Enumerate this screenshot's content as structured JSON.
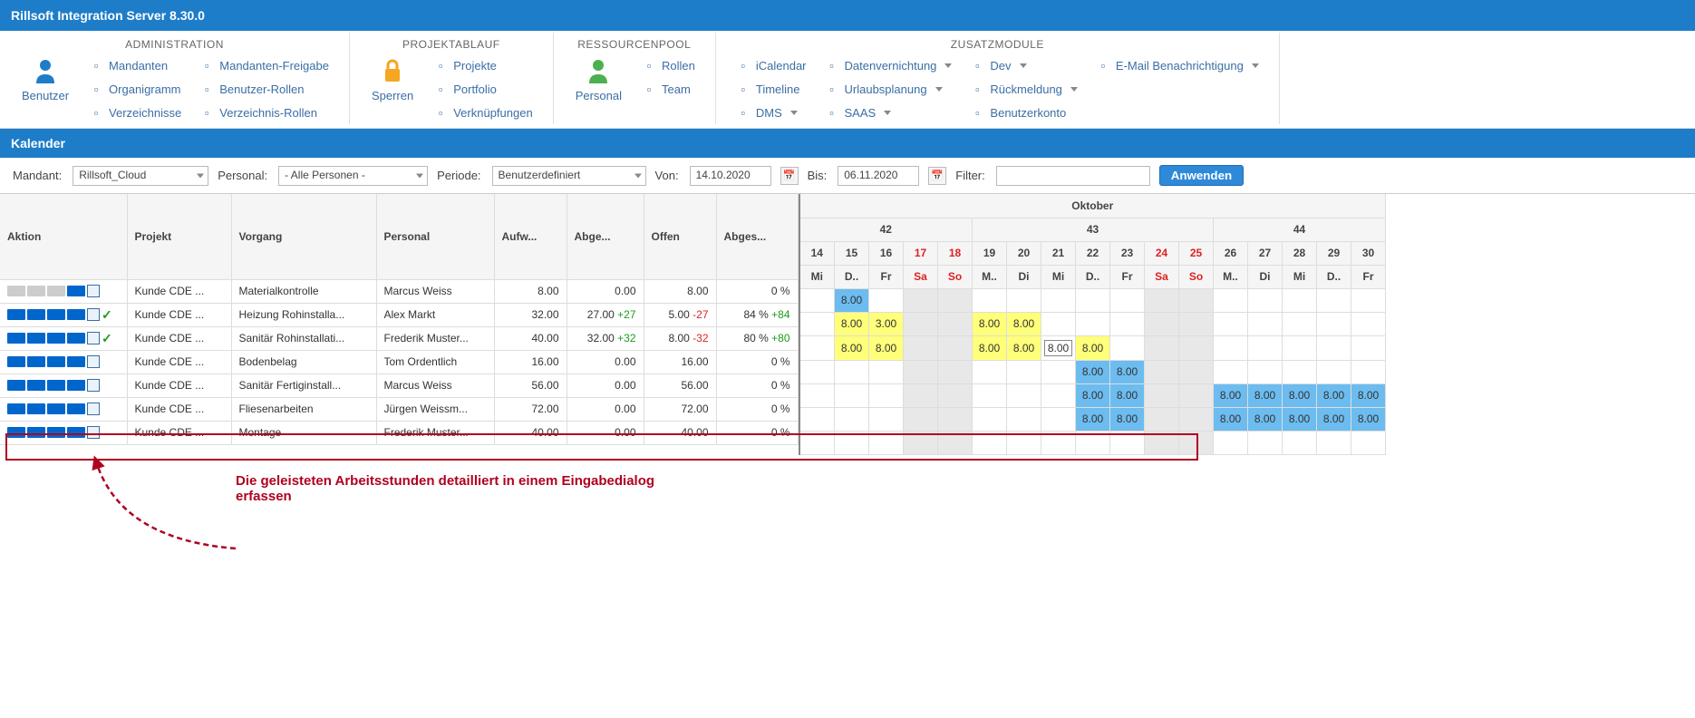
{
  "title": "Rillsoft Integration Server 8.30.0",
  "ribbon": {
    "groups": [
      {
        "title": "ADMINISTRATION",
        "big": {
          "label": "Benutzer"
        },
        "cols": [
          [
            "Mandanten",
            "Organigramm",
            "Verzeichnisse"
          ],
          [
            "Mandanten-Freigabe",
            "Benutzer-Rollen",
            "Verzeichnis-Rollen"
          ]
        ]
      },
      {
        "title": "PROJEKTABLAUF",
        "big": {
          "label": "Sperren"
        },
        "cols": [
          [
            "Projekte",
            "Portfolio",
            "Verknüpfungen"
          ]
        ]
      },
      {
        "title": "RESSOURCENPOOL",
        "big": {
          "label": "Personal"
        },
        "cols": [
          [
            "Rollen",
            "Team"
          ]
        ]
      },
      {
        "title": "ZUSATZMODULE",
        "cols": [
          [
            {
              "l": "iCalendar"
            },
            {
              "l": "Timeline"
            },
            {
              "l": "DMS",
              "d": true
            }
          ],
          [
            {
              "l": "Datenvernichtung",
              "d": true
            },
            {
              "l": "Urlaubsplanung",
              "d": true
            },
            {
              "l": "SAAS",
              "d": true
            }
          ],
          [
            {
              "l": "Dev",
              "d": true
            },
            {
              "l": "Rückmeldung",
              "d": true
            },
            {
              "l": "Benutzerkonto"
            }
          ],
          [
            {
              "l": "E-Mail Benachrichtigung",
              "d": true
            }
          ]
        ]
      }
    ]
  },
  "section": "Kalender",
  "filters": {
    "mandant_lbl": "Mandant:",
    "mandant_val": "Rillsoft_Cloud",
    "personal_lbl": "Personal:",
    "personal_val": "- Alle Personen -",
    "periode_lbl": "Periode:",
    "periode_val": "Benutzerdefiniert",
    "von_lbl": "Von:",
    "von_val": "14.10.2020",
    "bis_lbl": "Bis:",
    "bis_val": "06.11.2020",
    "filter_lbl": "Filter:",
    "apply": "Anwenden"
  },
  "headers": [
    "Aktion",
    "Projekt",
    "Vorgang",
    "Personal",
    "Aufw...",
    "Abge...",
    "Offen",
    "Abges..."
  ],
  "month": "Oktober",
  "weeks": [
    "42",
    "43",
    "44"
  ],
  "days": [
    {
      "n": "14",
      "d": "Mi"
    },
    {
      "n": "15",
      "d": "D.."
    },
    {
      "n": "16",
      "d": "Fr"
    },
    {
      "n": "17",
      "d": "Sa",
      "w": true
    },
    {
      "n": "18",
      "d": "So",
      "w": true
    },
    {
      "n": "19",
      "d": "M.."
    },
    {
      "n": "20",
      "d": "Di"
    },
    {
      "n": "21",
      "d": "Mi"
    },
    {
      "n": "22",
      "d": "D.."
    },
    {
      "n": "23",
      "d": "Fr"
    },
    {
      "n": "24",
      "d": "Sa",
      "w": true
    },
    {
      "n": "25",
      "d": "So",
      "w": true
    },
    {
      "n": "26",
      "d": "M.."
    },
    {
      "n": "27",
      "d": "Di"
    },
    {
      "n": "28",
      "d": "Mi"
    },
    {
      "n": "29",
      "d": "D.."
    },
    {
      "n": "30",
      "d": "Fr"
    }
  ],
  "rows": [
    {
      "projekt": "Kunde CDE ...",
      "vorgang": "Materialkontrolle",
      "personal": "Marcus Weiss",
      "aufw": "8.00",
      "abge": "0.00",
      "offen": "8.00",
      "pct": "0 %",
      "cells": {
        "1": {
          "v": "8.00",
          "c": "b"
        }
      },
      "progGray": [
        true,
        true,
        true,
        false
      ],
      "check": false
    },
    {
      "projekt": "Kunde CDE ...",
      "vorgang": "Heizung Rohinstalla...",
      "personal": "Alex Markt",
      "aufw": "32.00",
      "abge": "27.00",
      "abge_d": "+27",
      "offen": "5.00",
      "offen_d": "-27",
      "pct": "84 %",
      "pct_d": "+84",
      "cells": {
        "1": {
          "v": "8.00",
          "c": "y"
        },
        "2": {
          "v": "3.00",
          "c": "y"
        },
        "5": {
          "v": "8.00",
          "c": "y"
        },
        "6": {
          "v": "8.00",
          "c": "y"
        }
      },
      "progGray": [
        false,
        false,
        false,
        false
      ],
      "check": true
    },
    {
      "projekt": "Kunde CDE ...",
      "vorgang": "Sanitär Rohinstallati...",
      "personal": "Frederik Muster...",
      "aufw": "40.00",
      "abge": "32.00",
      "abge_d": "+32",
      "offen": "8.00",
      "offen_d": "-32",
      "pct": "80 %",
      "pct_d": "+80",
      "cells": {
        "1": {
          "v": "8.00",
          "c": "y"
        },
        "2": {
          "v": "8.00",
          "c": "y"
        },
        "5": {
          "v": "8.00",
          "c": "y"
        },
        "6": {
          "v": "8.00",
          "c": "y"
        },
        "7": {
          "v": "8.00",
          "c": "i"
        },
        "8": {
          "v": "8.00",
          "c": "y"
        }
      },
      "progGray": [
        false,
        false,
        false,
        false
      ],
      "check": true
    },
    {
      "projekt": "Kunde CDE ...",
      "vorgang": "Bodenbelag",
      "personal": "Tom Ordentlich",
      "aufw": "16.00",
      "abge": "0.00",
      "offen": "16.00",
      "pct": "0 %",
      "cells": {
        "8": {
          "v": "8.00",
          "c": "b"
        },
        "9": {
          "v": "8.00",
          "c": "b"
        }
      },
      "progGray": [
        false,
        false,
        false,
        false
      ],
      "check": false,
      "highlight": true
    },
    {
      "projekt": "Kunde CDE ...",
      "vorgang": "Sanitär Fertiginstall...",
      "personal": "Marcus Weiss",
      "aufw": "56.00",
      "abge": "0.00",
      "offen": "56.00",
      "pct": "0 %",
      "cells": {
        "8": {
          "v": "8.00",
          "c": "b"
        },
        "9": {
          "v": "8.00",
          "c": "b"
        },
        "12": {
          "v": "8.00",
          "c": "b"
        },
        "13": {
          "v": "8.00",
          "c": "b"
        },
        "14": {
          "v": "8.00",
          "c": "b"
        },
        "15": {
          "v": "8.00",
          "c": "b"
        },
        "16": {
          "v": "8.00",
          "c": "b"
        }
      },
      "progGray": [
        false,
        false,
        false,
        false
      ],
      "check": false
    },
    {
      "projekt": "Kunde CDE ...",
      "vorgang": "Fliesenarbeiten",
      "personal": "Jürgen Weissm...",
      "aufw": "72.00",
      "abge": "0.00",
      "offen": "72.00",
      "pct": "0 %",
      "cells": {
        "8": {
          "v": "8.00",
          "c": "b"
        },
        "9": {
          "v": "8.00",
          "c": "b"
        },
        "12": {
          "v": "8.00",
          "c": "b"
        },
        "13": {
          "v": "8.00",
          "c": "b"
        },
        "14": {
          "v": "8.00",
          "c": "b"
        },
        "15": {
          "v": "8.00",
          "c": "b"
        },
        "16": {
          "v": "8.00",
          "c": "b"
        }
      },
      "progGray": [
        false,
        false,
        false,
        false
      ],
      "check": false
    },
    {
      "projekt": "Kunde CDE ...",
      "vorgang": "Montage",
      "personal": "Frederik Muster...",
      "aufw": "40.00",
      "abge": "0.00",
      "offen": "40.00",
      "pct": "0 %",
      "cells": {},
      "progGray": [
        false,
        false,
        false,
        false
      ],
      "check": false
    }
  ],
  "annotation": "Die geleisteten Arbeitsstunden detailliert in einem Eingabedialog erfassen",
  "widths": {
    "aktion": 140,
    "projekt": 115,
    "vorgang": 160,
    "personal": 130,
    "aufw": 80,
    "abge": 85,
    "offen": 80,
    "pct": 90
  }
}
